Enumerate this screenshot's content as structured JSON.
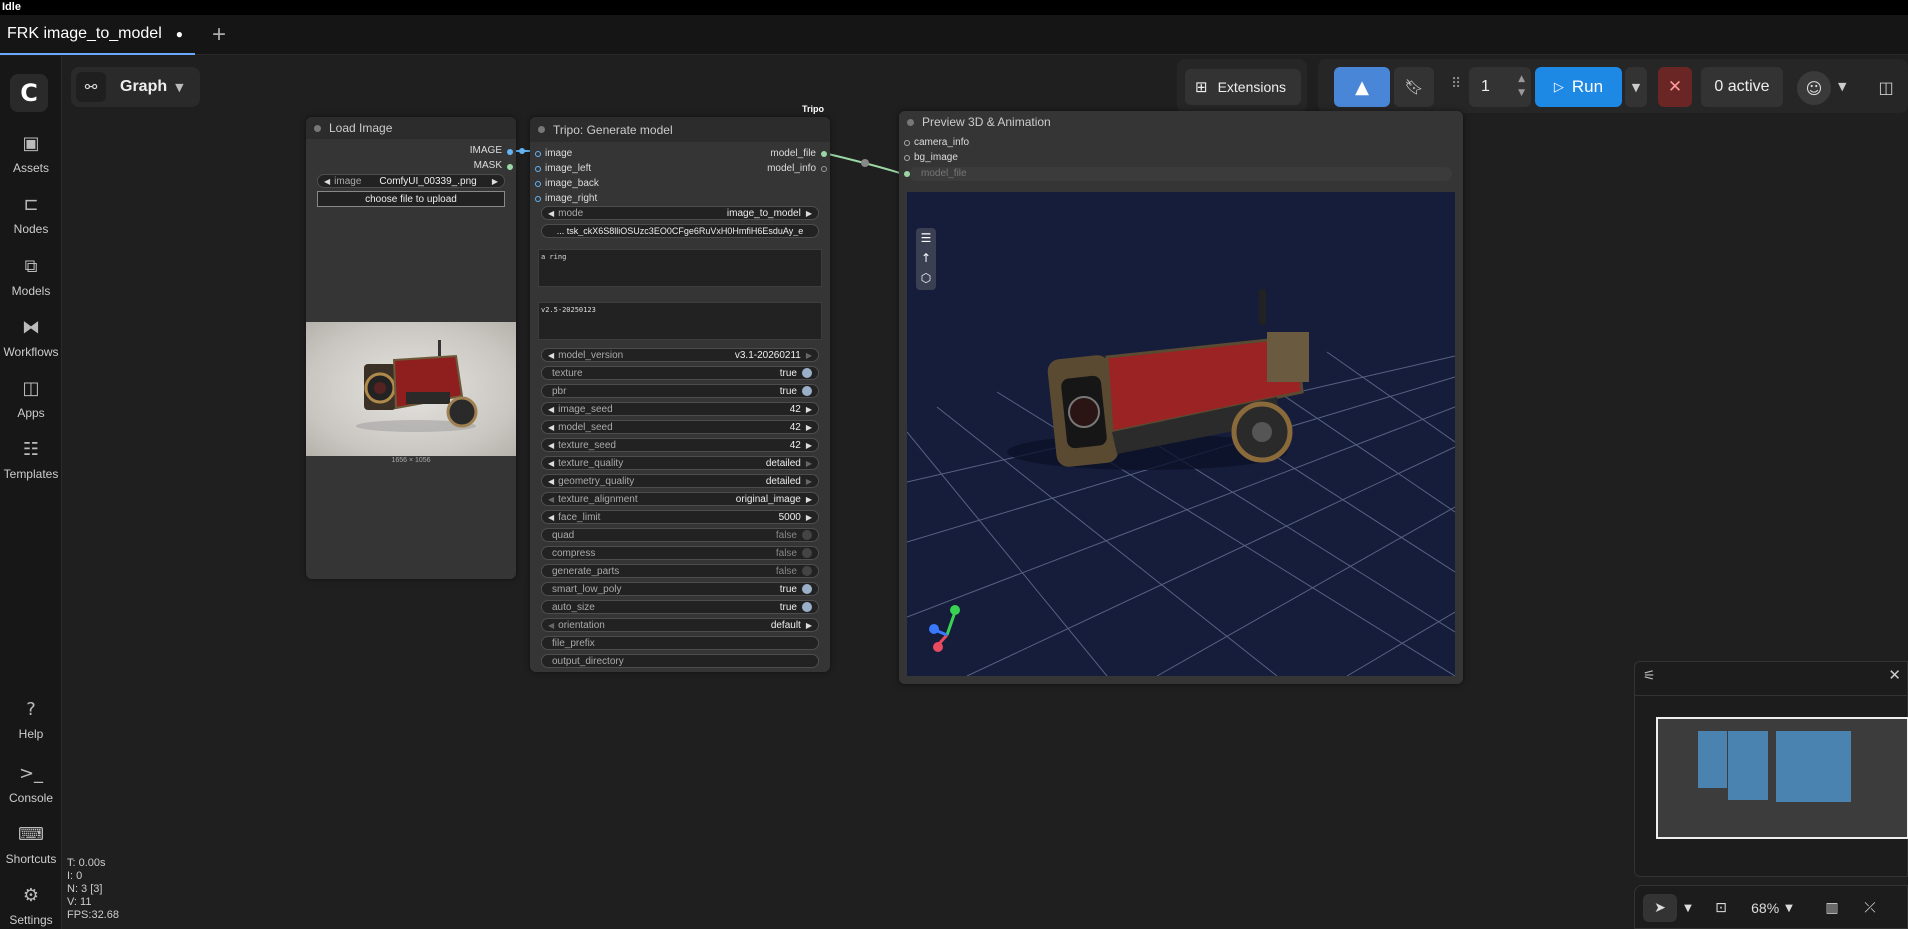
{
  "status": "Idle",
  "tabs": [
    {
      "label": "FRK image_to_model",
      "modified_mark": "●"
    }
  ],
  "new_tab_icon": "+",
  "sidebar": {
    "logo": "C",
    "items": [
      {
        "label": "Assets",
        "icon": "image-icon"
      },
      {
        "label": "Nodes",
        "icon": "nodes-icon"
      },
      {
        "label": "Models",
        "icon": "models-icon"
      },
      {
        "label": "Workflows",
        "icon": "workflows-icon"
      },
      {
        "label": "Apps",
        "icon": "apps-icon"
      },
      {
        "label": "Templates",
        "icon": "templates-icon"
      },
      {
        "label": "Help",
        "icon": "help-icon"
      },
      {
        "label": "Console",
        "icon": "console-icon"
      },
      {
        "label": "Shortcuts",
        "icon": "keyboard-icon"
      },
      {
        "label": "Settings",
        "icon": "gear-icon"
      }
    ]
  },
  "graph_button": {
    "label": "Graph"
  },
  "toolbar": {
    "extensions_label": "Extensions",
    "batch_count": "1",
    "run_label": "Run",
    "active_label": "0 active"
  },
  "nodes": {
    "load_image": {
      "title": "Load Image",
      "outputs": [
        "IMAGE",
        "MASK"
      ],
      "image_widget_label": "image",
      "image_widget_value": "ComfyUI_00339_.png",
      "upload_label": "choose file to upload",
      "image_size": "1656 × 1056"
    },
    "tripo": {
      "badge": "Tripo",
      "title": "Tripo: Generate model",
      "inputs": [
        "image",
        "image_left",
        "image_back",
        "image_right"
      ],
      "outputs": [
        "model_file",
        "model_info"
      ],
      "mode_label": "mode",
      "mode_value": "image_to_model",
      "api_key": "... tsk_ckX6S8lliOSUzc3EO0CFge6RuVxH0HmfiH6EsduAy_e",
      "prompt": "a ring",
      "negative": "v2.5-20250123",
      "widgets": [
        {
          "label": "model_version",
          "value": "v3.1-20260211",
          "kind": "combo",
          "right_dim": true
        },
        {
          "label": "texture",
          "value": "true",
          "kind": "toggle",
          "on": true
        },
        {
          "label": "pbr",
          "value": "true",
          "kind": "toggle",
          "on": true
        },
        {
          "label": "image_seed",
          "value": "42",
          "kind": "number"
        },
        {
          "label": "model_seed",
          "value": "42",
          "kind": "number"
        },
        {
          "label": "texture_seed",
          "value": "42",
          "kind": "number"
        },
        {
          "label": "texture_quality",
          "value": "detailed",
          "kind": "combo",
          "right_dim": true
        },
        {
          "label": "geometry_quality",
          "value": "detailed",
          "kind": "combo",
          "right_dim": true
        },
        {
          "label": "texture_alignment",
          "value": "original_image",
          "kind": "combo",
          "left_dim": true
        },
        {
          "label": "face_limit",
          "value": "5000",
          "kind": "number"
        },
        {
          "label": "quad",
          "value": "false",
          "kind": "toggle",
          "on": false
        },
        {
          "label": "compress",
          "value": "false",
          "kind": "toggle",
          "on": false
        },
        {
          "label": "generate_parts",
          "value": "false",
          "kind": "toggle",
          "on": false
        },
        {
          "label": "smart_low_poly",
          "value": "true",
          "kind": "toggle",
          "on": true
        },
        {
          "label": "auto_size",
          "value": "true",
          "kind": "toggle",
          "on": true
        },
        {
          "label": "orientation",
          "value": "default",
          "kind": "combo",
          "left_dim": true
        },
        {
          "label": "file_prefix",
          "value": "",
          "kind": "text"
        },
        {
          "label": "output_directory",
          "value": "",
          "kind": "text"
        }
      ]
    },
    "preview3d": {
      "title": "Preview 3D & Animation",
      "inputs": [
        "camera_info",
        "bg_image"
      ],
      "model_file_widget": "model_file"
    }
  },
  "zoom_label": "68%",
  "stats": [
    "T: 0.00s",
    "I: 0",
    "N: 3 [3]",
    "V: 11",
    "FPS:32.68"
  ],
  "colors": {
    "accent": "#1e88e5",
    "link": "#9bd7a4",
    "image_port": "#64b5f6",
    "viewport_bg": "#151d3b"
  }
}
